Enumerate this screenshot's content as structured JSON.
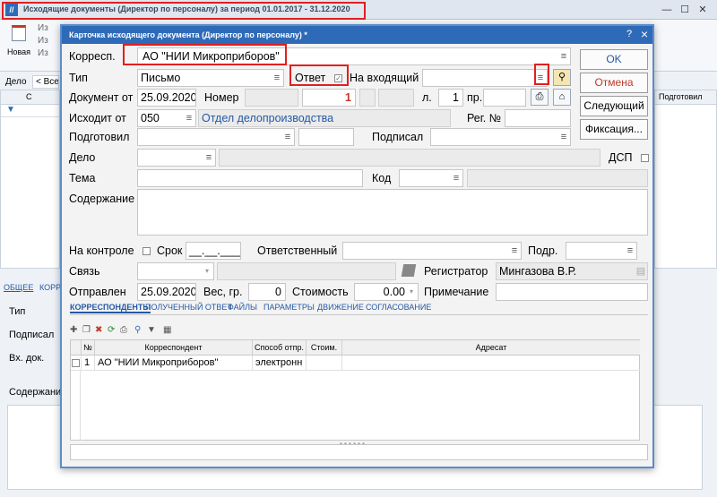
{
  "outer_window": {
    "title": "Исходящие документы (Директор по персоналу)  за период 01.01.2017 - 31.12.2020",
    "min_icon": "minimize-icon",
    "max_icon": "maximize-icon",
    "close_icon": "close-icon",
    "ribbon_new_label": "Новая",
    "ribbon_item1": "Из",
    "ribbon_item2": "Из",
    "ribbon_item3": "Из",
    "delo_label": "Дело",
    "delo_value": "< Все",
    "col_header": "Подготовил",
    "col_header2": "Подготовил",
    "bottom_tab_general": "ОБЩЕЕ",
    "bottom_tab_corr": "КОРР",
    "bottom_type_label": "Тип",
    "bottom_signed_label": "Подписал",
    "bottom_in_label": "Вх. док.",
    "bottom_content_label": "Содержание",
    "right_label": "Подготовил"
  },
  "dialog": {
    "title": "Карточка исходящего документа (Директор по персоналу) *",
    "help": "?",
    "close": "×",
    "labels": {
      "corresp": "Корресп.",
      "type": "Тип",
      "doc_from": "Документ от",
      "number": "Номер",
      "l": "л.",
      "pr": "пр.",
      "outgoing_from": "Исходит от",
      "reg_no": "Рег. №",
      "prepared": "Подготовил",
      "signed": "Подписал",
      "case": "Дело",
      "dsp": "ДСП",
      "topic": "Тема",
      "code": "Код",
      "content": "Содержание",
      "on_control": "На контроле",
      "term": "Срок",
      "responsible": "Ответственный",
      "subdiv": "Подр.",
      "link": "Связь",
      "registrar": "Регистратор",
      "sent": "Отправлен",
      "weight": "Вес, гр.",
      "cost": "Стоимость",
      "note": "Примечание",
      "answer": "Ответ",
      "on_incoming": "На входящий"
    },
    "values": {
      "corresp": "АО \"НИИ Микроприборов\"",
      "type": "Письмо",
      "doc_date": "25.09.2020",
      "number": "1",
      "l": "1",
      "outgoing_code": "050",
      "outgoing_dept": "Отдел делопроизводства",
      "term": "__.__.____",
      "registrar": "Мингазова В.Р.",
      "sent_date": "25.09.2020",
      "weight": "0",
      "cost": "0.00"
    },
    "buttons": {
      "ok": "OK",
      "cancel": "Отмена",
      "next": "Следующий",
      "fix": "Фиксация..."
    },
    "tabs": [
      "КОРРЕСПОНДЕНТЫ",
      "ПОЛУЧЕННЫЙ ОТВЕТ",
      "ФАЙЛЫ",
      "ПАРАМЕТРЫ",
      "ДВИЖЕНИЕ",
      "СОГЛАСОВАНИЕ"
    ],
    "table": {
      "headers": [
        "№",
        "Корреспондент",
        "Способ отпр.",
        "Стоим.",
        "Адресат"
      ],
      "rows": [
        {
          "num": "1",
          "corresp": "АО \"НИИ Микроприборов\"",
          "method": "электронн",
          "cost": "",
          "addressee": ""
        }
      ]
    },
    "colors": {
      "accent": "#2f6ab8",
      "highlight": "#e02020",
      "number": "#c0392b",
      "link": "#2459a5"
    }
  }
}
